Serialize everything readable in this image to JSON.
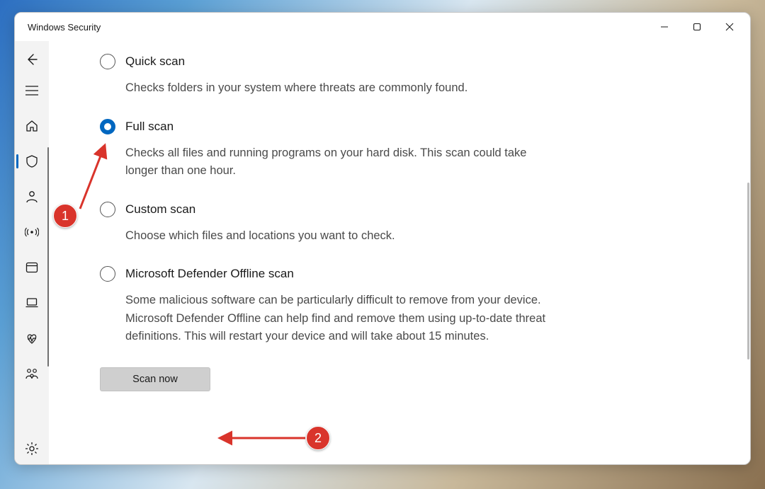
{
  "window": {
    "title": "Windows Security"
  },
  "options": [
    {
      "id": "quick",
      "title": "Quick scan",
      "desc": "Checks folders in your system where threats are commonly found.",
      "selected": false
    },
    {
      "id": "full",
      "title": "Full scan",
      "desc": "Checks all files and running programs on your hard disk. This scan could take longer than one hour.",
      "selected": true
    },
    {
      "id": "custom",
      "title": "Custom scan",
      "desc": "Choose which files and locations you want to check.",
      "selected": false
    },
    {
      "id": "offline",
      "title": "Microsoft Defender Offline scan",
      "desc": "Some malicious software can be particularly difficult to remove from your device. Microsoft Defender Offline can help find and remove them using up-to-date threat definitions. This will restart your device and will take about 15 minutes.",
      "selected": false
    }
  ],
  "buttons": {
    "scan_now": "Scan now"
  },
  "annotations": {
    "badge1": "1",
    "badge2": "2"
  }
}
